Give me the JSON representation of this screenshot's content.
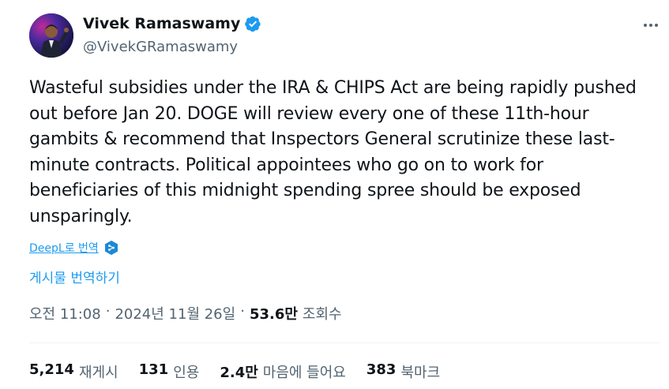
{
  "author": {
    "name": "Vivek Ramaswamy",
    "handle": "@VivekGRamaswamy",
    "verified_color": "#1d9bf0"
  },
  "tweet": {
    "text": "Wasteful subsidies under the IRA & CHIPS Act are being rapidly pushed out before Jan 20. DOGE will review every one of these 11th-hour gambits & recommend that Inspectors General scrutinize these last-minute contracts. Political appointees who go on to work for beneficiaries of this midnight spending spree should be exposed unsparingly."
  },
  "translate": {
    "deepl_label": "DeepL로 번역",
    "post_label": "게시물 번역하기"
  },
  "meta": {
    "time": "오전 11:08",
    "sep": "·",
    "date": "2024년 11월 26일",
    "views_count": "53.6만",
    "views_label": "조회수"
  },
  "stats": {
    "retweets_count": "5,214",
    "retweets_label": "재게시",
    "quotes_count": "131",
    "quotes_label": "인용",
    "likes_count": "2.4만",
    "likes_label": "마음에 들어요",
    "bookmarks_count": "383",
    "bookmarks_label": "북마크"
  },
  "icons": {
    "verified": "verified-badge-icon",
    "more": "more-options-icon",
    "deepl": "deepl-logo-icon"
  }
}
